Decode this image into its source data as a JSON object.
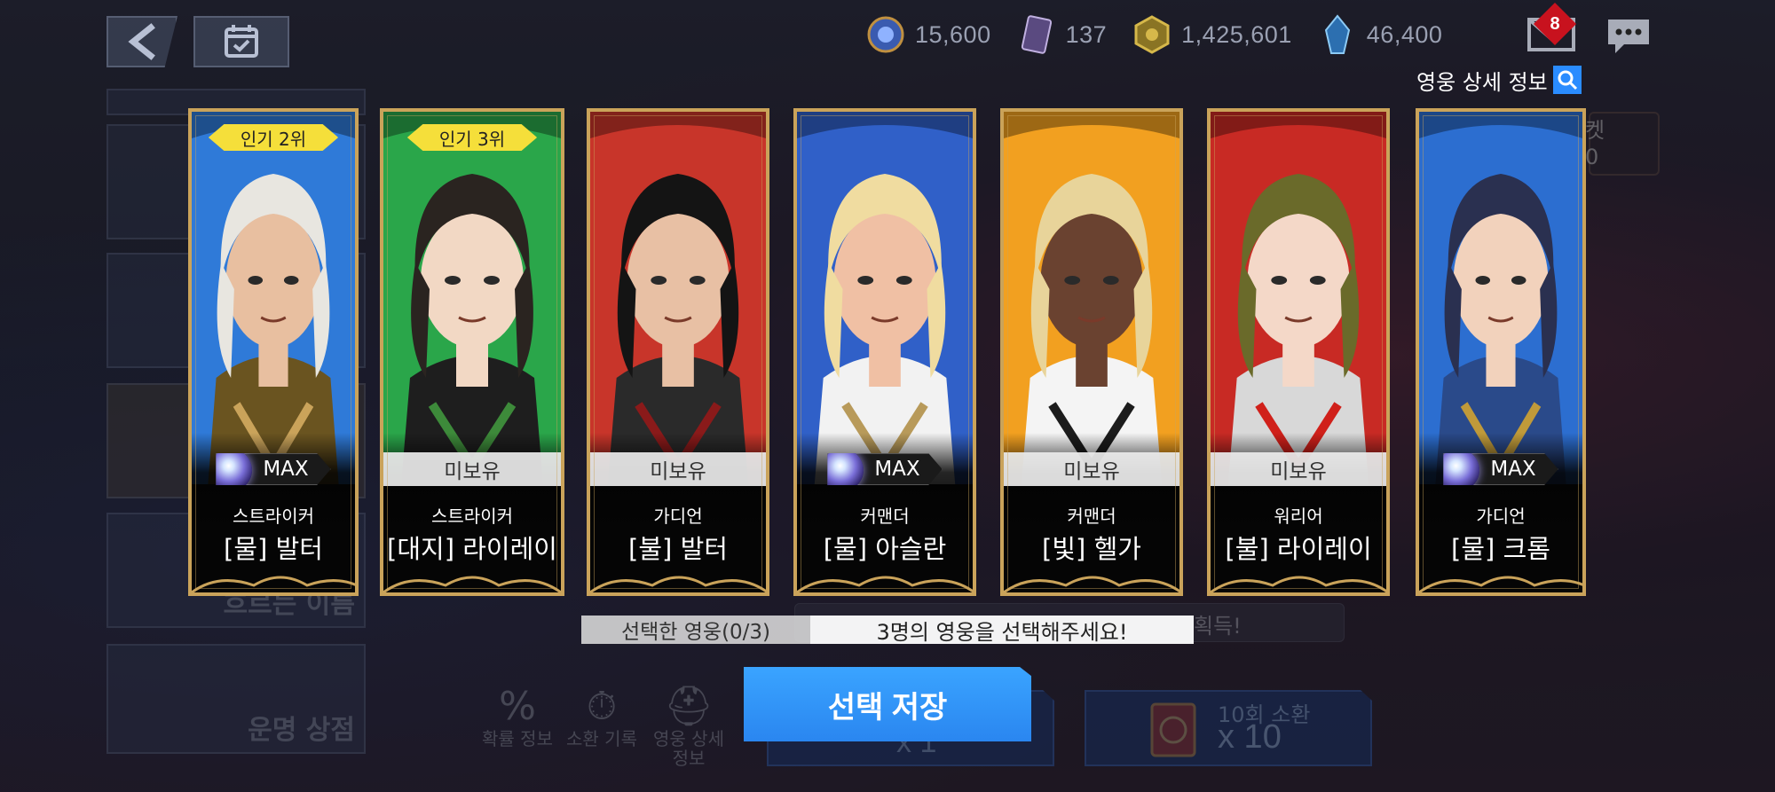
{
  "header": {
    "currencies": [
      {
        "icon": "blue-gem-orb-icon",
        "value": "15,600"
      },
      {
        "icon": "summon-ticket-icon",
        "value": "137"
      },
      {
        "icon": "gold-coin-icon",
        "value": "1,425,601"
      },
      {
        "icon": "blue-crystal-icon",
        "value": "46,400"
      }
    ],
    "mail_badge": "8",
    "hero_detail_link": "영웅 상세 정보"
  },
  "sidebar": {
    "items": [
      {
        "label": "흐르는 이름"
      },
      {
        "label": "운명 상점"
      }
    ]
  },
  "right_ticket": {
    "label": "켓",
    "count": "0"
  },
  "cards": [
    {
      "rank": "인기 2위",
      "status": "MAX",
      "status_type": "max",
      "class": "스트라이커",
      "name": "[물] 발터"
    },
    {
      "rank": "인기 3위",
      "status": "미보유",
      "status_type": "unowned",
      "class": "스트라이커",
      "name": "[대지] 라이레이"
    },
    {
      "rank": "",
      "status": "미보유",
      "status_type": "unowned",
      "class": "가디언",
      "name": "[불] 발터"
    },
    {
      "rank": "",
      "status": "MAX",
      "status_type": "max",
      "class": "커맨더",
      "name": "[물] 아슬란"
    },
    {
      "rank": "",
      "status": "미보유",
      "status_type": "unowned",
      "class": "커맨더",
      "name": "[빛] 헬가"
    },
    {
      "rank": "",
      "status": "미보유",
      "status_type": "unowned",
      "class": "워리어",
      "name": "[불] 라이레이"
    },
    {
      "rank": "",
      "status": "MAX",
      "status_type": "max",
      "class": "가디언",
      "name": "[물] 크롬"
    }
  ],
  "selection": {
    "count_label": "선택한 영웅(0/3)",
    "message": "3명의 영웅을 선택해주세요!",
    "background_banner": "획득!"
  },
  "actions": {
    "save_label": "선택 저장",
    "summon_10_label": "10회 소환",
    "summon_10_count": "x 10",
    "summon_1_count": "x 1"
  },
  "utilities": [
    {
      "icon": "percent-icon",
      "label": "확률 정보"
    },
    {
      "icon": "stopwatch-magnifier-icon",
      "label": "소환 기록"
    },
    {
      "icon": "helmet-magnifier-icon",
      "label": "영웅 상세 정보"
    }
  ],
  "colors": {
    "card_border": "#caa35a",
    "rank_banner": "#f5df3a",
    "save_button": "#2a86f0",
    "search_button": "#2a8cff",
    "mail_badge": "#c8121e"
  }
}
